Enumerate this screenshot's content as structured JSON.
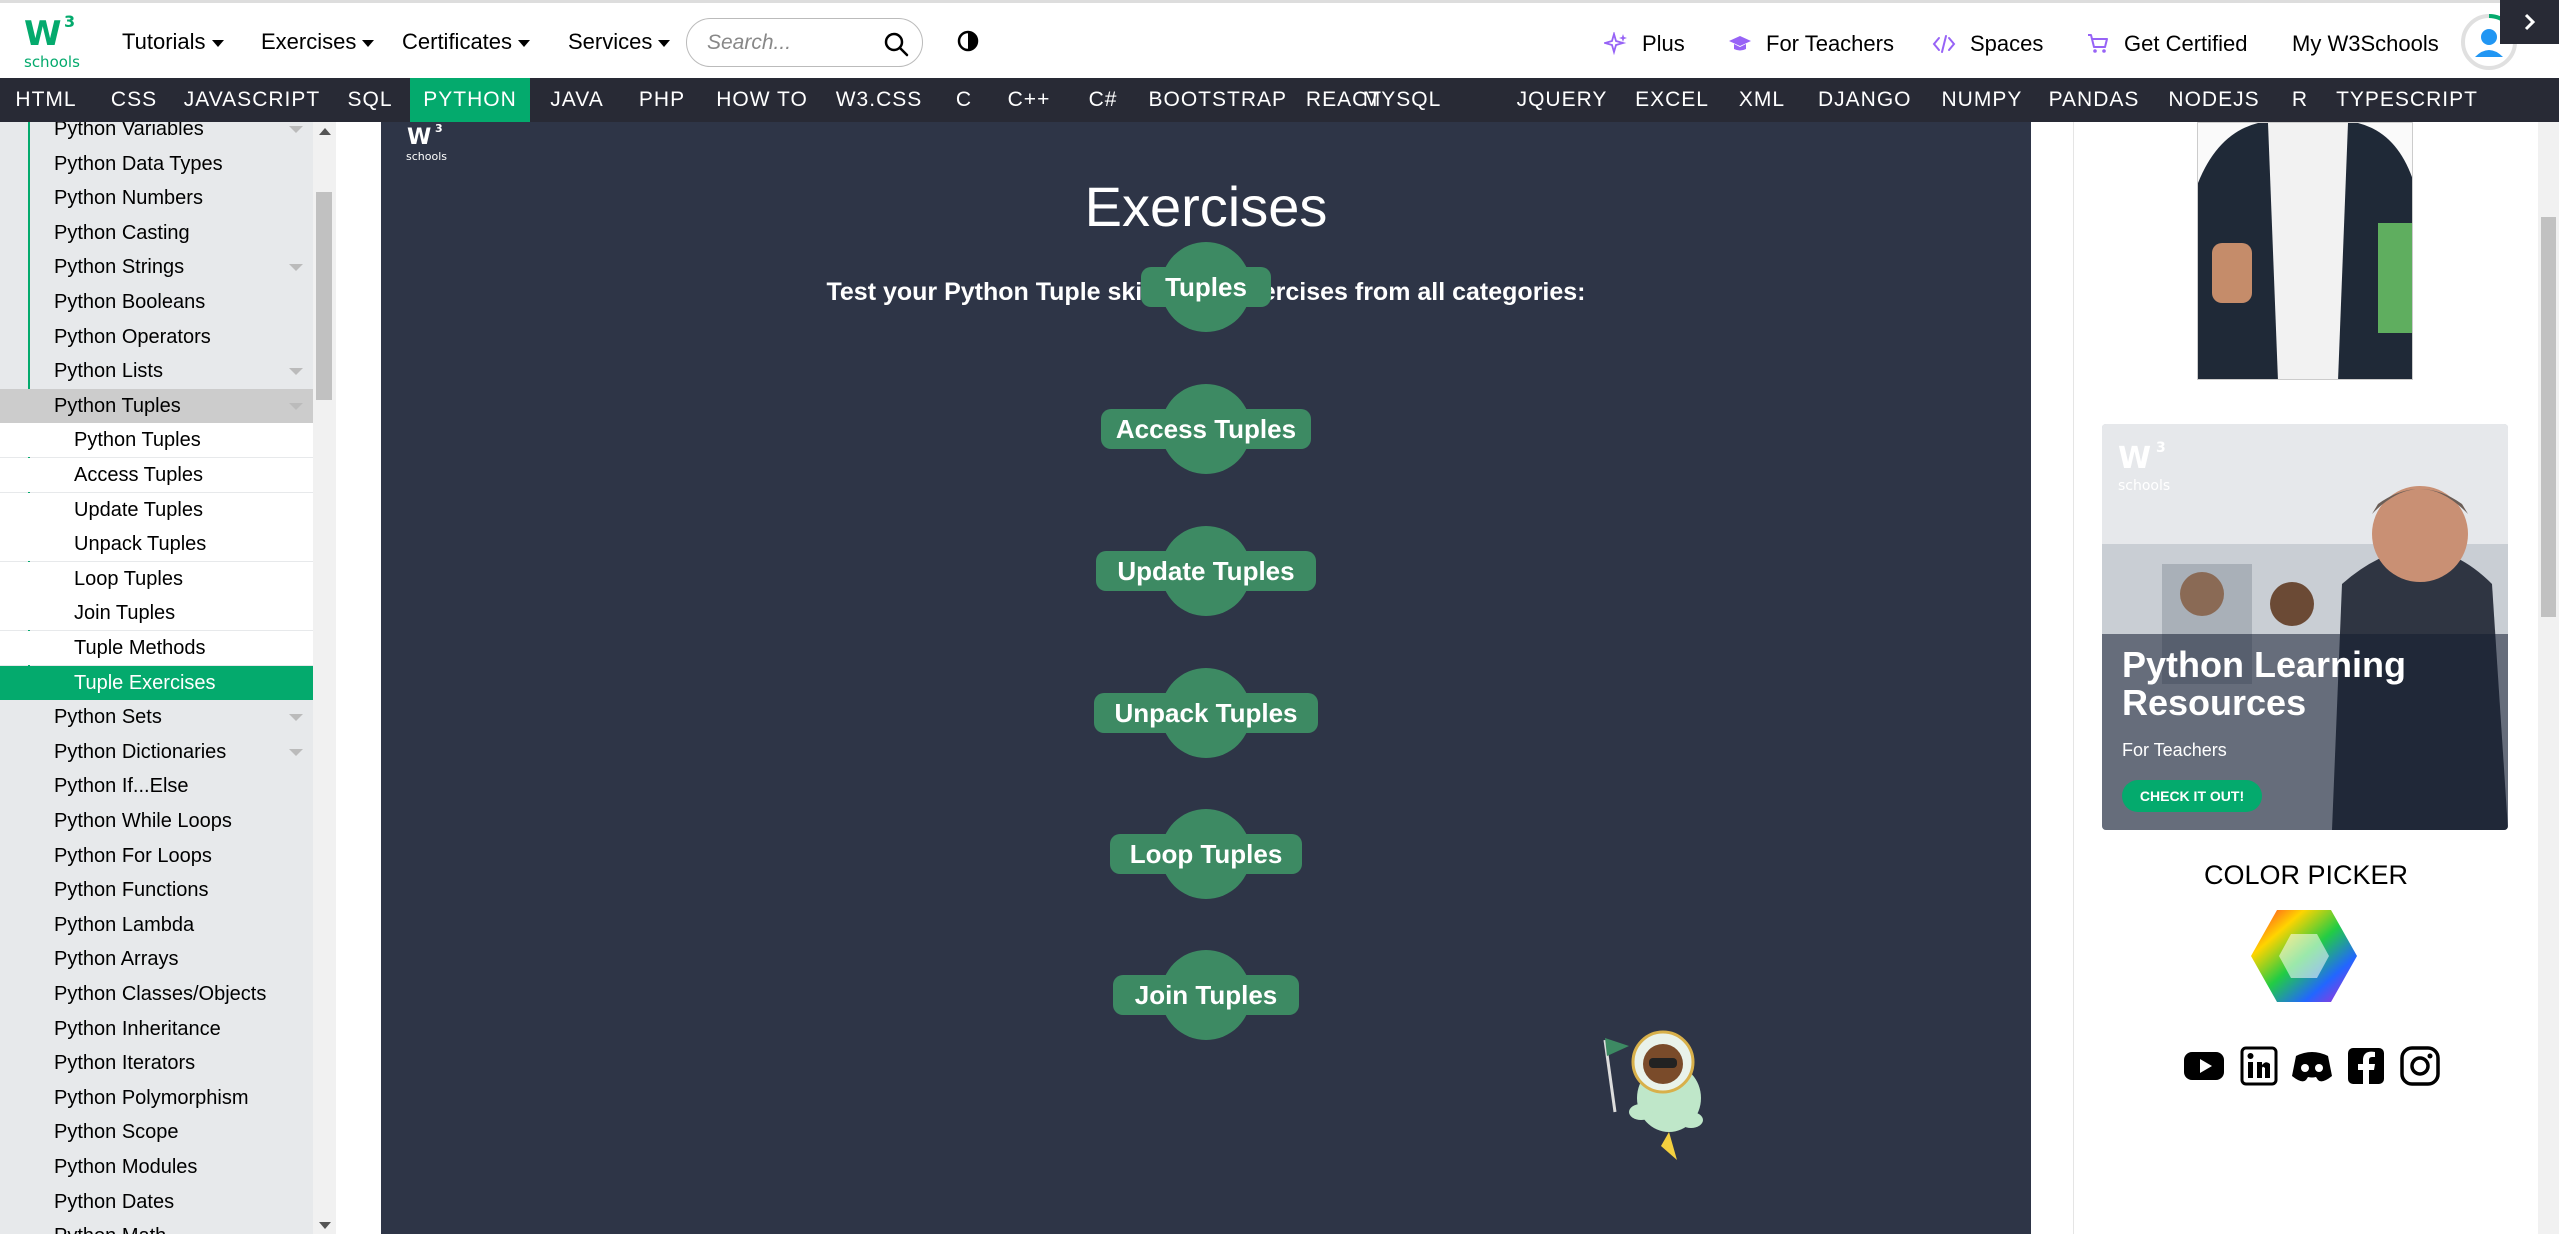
{
  "header": {
    "logo_text": "schools",
    "nav": [
      "Tutorials",
      "Exercises",
      "Certificates",
      "Services"
    ],
    "search_placeholder": "Search...",
    "right_links": [
      "Plus",
      "For Teachers",
      "Spaces",
      "Get Certified",
      "My W3Schools"
    ]
  },
  "subjects": [
    "HTML",
    "CSS",
    "JAVASCRIPT",
    "SQL",
    "PYTHON",
    "JAVA",
    "PHP",
    "HOW TO",
    "W3.CSS",
    "C",
    "C++",
    "C#",
    "BOOTSTRAP",
    "REACT",
    "MYSQL",
    "JQUERY",
    "EXCEL",
    "XML",
    "DJANGO",
    "NUMPY",
    "PANDAS",
    "NODEJS",
    "R",
    "TYPESCRIPT"
  ],
  "active_subject": "PYTHON",
  "sidebar": {
    "items": [
      "Python Variables",
      "Python Data Types",
      "Python Numbers",
      "Python Casting",
      "Python Strings",
      "Python Booleans",
      "Python Operators",
      "Python Lists",
      "Python Tuples",
      "Python Tuples",
      "Access Tuples",
      "Update Tuples",
      "Unpack Tuples",
      "Loop Tuples",
      "Join Tuples",
      "Tuple Methods",
      "Tuple Exercises",
      "Python Sets",
      "Python Dictionaries",
      "Python If...Else",
      "Python While Loops",
      "Python For Loops",
      "Python Functions",
      "Python Lambda",
      "Python Arrays",
      "Python Classes/Objects",
      "Python Inheritance",
      "Python Iterators",
      "Python Polymorphism",
      "Python Scope",
      "Python Modules",
      "Python Dates",
      "Python Math"
    ]
  },
  "main": {
    "logo_text": "schools",
    "title": "Exercises",
    "subtitle": "Test your Python Tuple skills with exercises from all categories:",
    "exercises": [
      "Tuples",
      "Access Tuples",
      "Update Tuples",
      "Unpack Tuples",
      "Loop Tuples",
      "Join Tuples"
    ]
  },
  "right": {
    "ad_logo_text": "schools",
    "ad_title": "Python Learning Resources",
    "ad_subtitle": "For Teachers",
    "ad_cta": "CHECK IT OUT!",
    "color_picker_title": "COLOR PICKER",
    "social": [
      "youtube-icon",
      "linkedin-icon",
      "discord-icon",
      "facebook-icon",
      "instagram-icon"
    ]
  },
  "colors": {
    "accent": "#04aa6d",
    "navbar": "#282a35",
    "main_bg": "#2e3547",
    "button": "#3d8a63"
  }
}
